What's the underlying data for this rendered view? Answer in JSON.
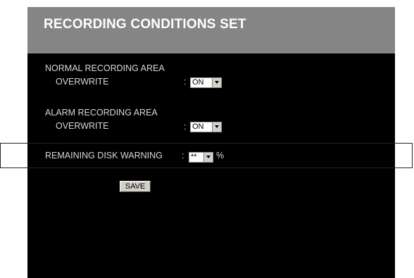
{
  "title": "RECORDING CONDITIONS SET",
  "normal_area": {
    "heading": "NORMAL RECORDING AREA",
    "overwrite_label": "OVERWRITE",
    "colon": ":",
    "overwrite_value": "ON"
  },
  "alarm_area": {
    "heading": "ALARM RECORDING AREA",
    "overwrite_label": "OVERWRITE",
    "colon": ":",
    "overwrite_value": "ON"
  },
  "disk_warning": {
    "label": "REMAINING DISK WARNING",
    "colon": ":",
    "value": "**",
    "unit": "%"
  },
  "save_label": "SAVE",
  "colors": {
    "panel_bg": "#000000",
    "title_bg": "#858585",
    "text": "#d8d8d8"
  },
  "icons": [
    "dropdown-arrow-icon"
  ]
}
